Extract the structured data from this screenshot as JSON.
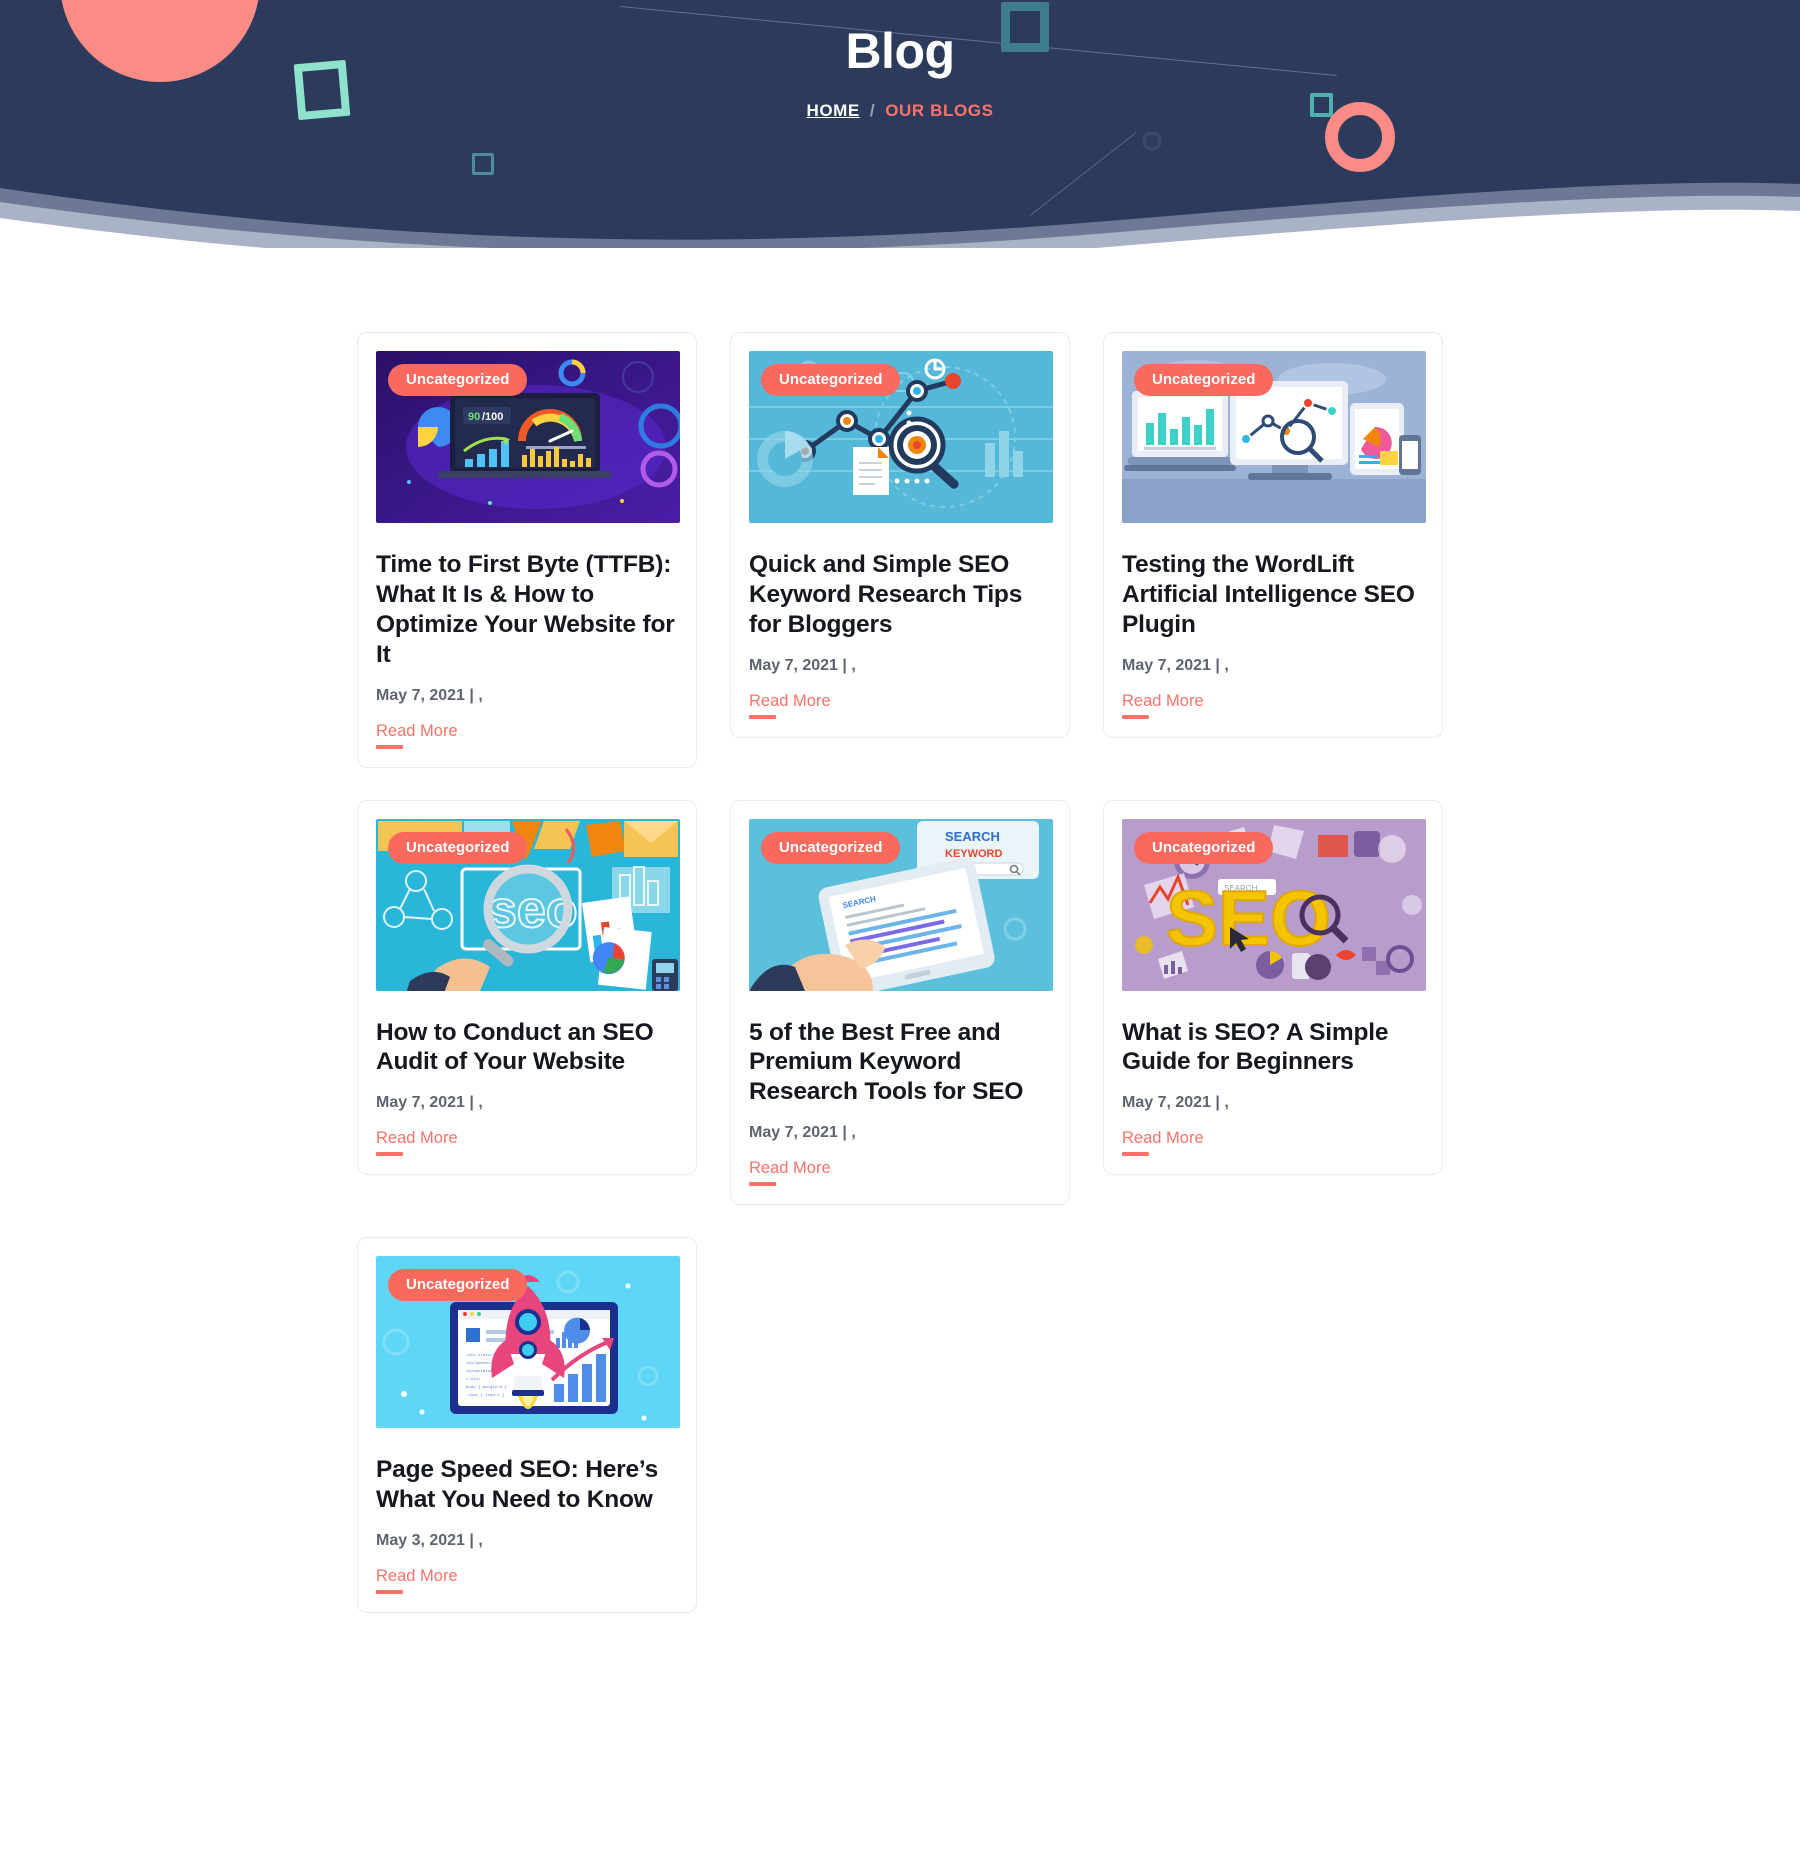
{
  "hero": {
    "title": "Blog",
    "breadcrumb": {
      "home": "HOME",
      "separator": "/",
      "current": "OUR BLOGS"
    },
    "background_color": "#2c3a5c",
    "accent_color": "#fb7268",
    "mint_color": "#8fe3cc"
  },
  "theme": {
    "accent": "#f9695d",
    "title_color": "#15181f",
    "date_color": "#5d6470",
    "card_border": "#e9ecf3"
  },
  "posts": [
    {
      "category": "Uncategorized",
      "title": "Time to First Byte (TTFB): What It Is & How to Optimize Your Website for It",
      "date": "May 7, 2021 | ,",
      "read_more": "Read More",
      "thumb_name": "ttfb-dashboard-illustration",
      "thumb_bg": "#3b1a86",
      "thumb_score": "90/100"
    },
    {
      "category": "Uncategorized",
      "title": "Quick and Simple SEO Keyword Research Tips for Bloggers",
      "date": "May 7, 2021 | ,",
      "read_more": "Read More",
      "thumb_name": "seo-keyword-analytics-illustration",
      "thumb_bg": "#55b8d8"
    },
    {
      "category": "Uncategorized",
      "title": "Testing the WordLift Artificial Intelligence SEO Plugin",
      "date": "May 7, 2021 | ,",
      "read_more": "Read More",
      "thumb_name": "multi-device-analytics-illustration",
      "thumb_bg": "#94aed3"
    },
    {
      "category": "Uncategorized",
      "title": "How to Conduct an SEO Audit of Your Website",
      "date": "May 7, 2021 | ,",
      "read_more": "Read More",
      "thumb_name": "seo-magnifier-desk-illustration",
      "thumb_bg": "#29b6d8"
    },
    {
      "category": "Uncategorized",
      "title": "5 of the Best Free and Premium Keyword Research Tools for SEO",
      "date": "May 7, 2021 | ,",
      "read_more": "Read More",
      "thumb_name": "tablet-search-keyword-illustration",
      "thumb_bg": "#5cc0dd"
    },
    {
      "category": "Uncategorized",
      "title": "What is SEO? A Simple Guide for Beginners",
      "date": "May 7, 2021 | ,",
      "read_more": "Read More",
      "thumb_name": "seo-letters-purple-illustration",
      "thumb_bg": "#b79ccc"
    },
    {
      "category": "Uncategorized",
      "title": "Page Speed SEO: Here’s What You Need to Know",
      "date": "May 3, 2021 | ,",
      "read_more": "Read More",
      "thumb_name": "rocket-page-speed-illustration",
      "thumb_bg": "#5fd6f5"
    }
  ]
}
